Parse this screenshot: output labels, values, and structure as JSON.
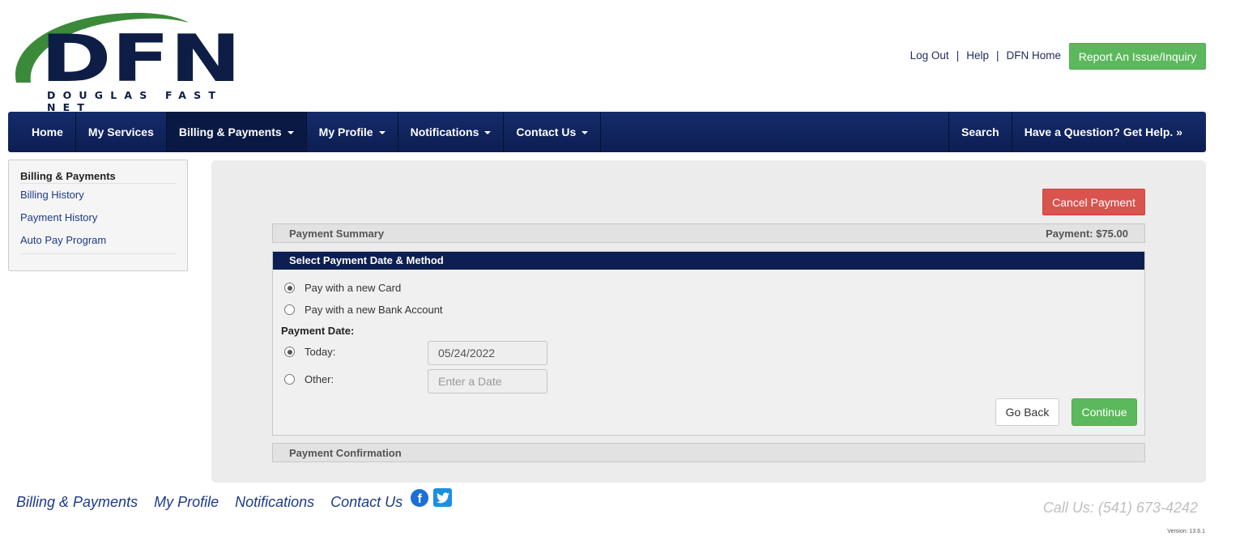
{
  "brand": {
    "logo_letters": "DFN",
    "logo_tagline": "DOUGLAS FAST NET",
    "colors": {
      "navy": "#0c1e52",
      "green": "#3a8a3a",
      "button_green": "#5cb85c",
      "button_red": "#d9534f"
    }
  },
  "header": {
    "links": [
      "Log Out",
      "Help",
      "DFN Home"
    ],
    "report_button": "Report An Issue/Inquiry"
  },
  "nav": {
    "items": [
      {
        "label": "Home",
        "dropdown": false
      },
      {
        "label": "My Services",
        "dropdown": false
      },
      {
        "label": "Billing & Payments",
        "dropdown": true
      },
      {
        "label": "My Profile",
        "dropdown": true
      },
      {
        "label": "Notifications",
        "dropdown": true
      },
      {
        "label": "Contact Us",
        "dropdown": true
      }
    ],
    "search": "Search",
    "help": "Have a Question? Get Help. »"
  },
  "sidebar": {
    "title": "Billing & Payments",
    "links": [
      "Billing History",
      "Payment History",
      "Auto Pay Program"
    ]
  },
  "main": {
    "cancel_button": "Cancel Payment",
    "summary": {
      "label": "Payment Summary",
      "amount": "Payment: $75.00"
    },
    "method": {
      "title": "Select Payment Date & Method",
      "options": [
        {
          "label": "Pay with a new Card",
          "selected": true
        },
        {
          "label": "Pay with a new Bank Account",
          "selected": false
        }
      ],
      "date_label": "Payment Date:",
      "today_label": "Today:",
      "today_value": "05/24/2022",
      "today_selected": true,
      "other_label": "Other:",
      "other_placeholder": "Enter a Date",
      "go_back": "Go Back",
      "continue": "Continue"
    },
    "confirmation": "Payment Confirmation"
  },
  "footer": {
    "links": [
      "Billing & Payments",
      "My Profile",
      "Notifications",
      "Contact Us"
    ],
    "social": [
      "facebook-icon",
      "twitter-icon"
    ],
    "call": "Call Us: (541) 673-4242",
    "version": "Version: 13.6.1"
  }
}
